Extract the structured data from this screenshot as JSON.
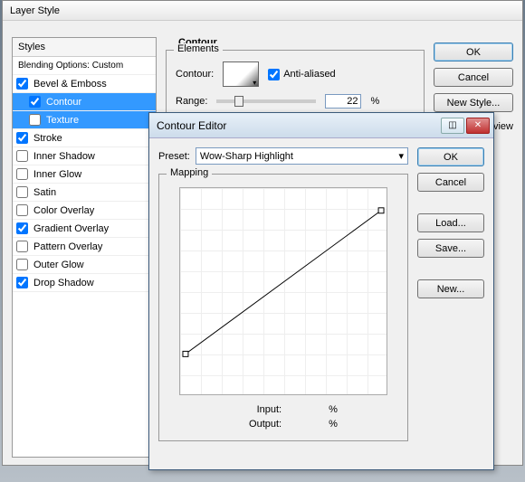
{
  "main": {
    "title": "Layer Style",
    "styles_header": "Styles",
    "blending_label": "Blending Options: Custom",
    "items": [
      {
        "label": "Bevel & Emboss",
        "checked": true,
        "selected": false,
        "sub": false
      },
      {
        "label": "Contour",
        "checked": true,
        "selected": true,
        "sub": true
      },
      {
        "label": "Texture",
        "checked": false,
        "selected": true,
        "sub": true
      },
      {
        "label": "Stroke",
        "checked": true,
        "selected": false,
        "sub": false
      },
      {
        "label": "Inner Shadow",
        "checked": false,
        "selected": false,
        "sub": false
      },
      {
        "label": "Inner Glow",
        "checked": false,
        "selected": false,
        "sub": false
      },
      {
        "label": "Satin",
        "checked": false,
        "selected": false,
        "sub": false
      },
      {
        "label": "Color Overlay",
        "checked": false,
        "selected": false,
        "sub": false
      },
      {
        "label": "Gradient Overlay",
        "checked": true,
        "selected": false,
        "sub": false
      },
      {
        "label": "Pattern Overlay",
        "checked": false,
        "selected": false,
        "sub": false
      },
      {
        "label": "Outer Glow",
        "checked": false,
        "selected": false,
        "sub": false
      },
      {
        "label": "Drop Shadow",
        "checked": true,
        "selected": false,
        "sub": false
      }
    ],
    "section_title": "Contour",
    "elements_legend": "Elements",
    "contour_label": "Contour:",
    "antialias_label": "Anti-aliased",
    "antialias_checked": true,
    "range_label": "Range:",
    "range_value": "22",
    "range_unit": "%",
    "buttons": {
      "ok": "OK",
      "cancel": "Cancel",
      "new_style": "New Style...",
      "preview": "Preview",
      "preview_checked": true
    }
  },
  "dialog": {
    "title": "Contour Editor",
    "preset_label": "Preset:",
    "preset_value": "Wow-Sharp Highlight",
    "mapping_legend": "Mapping",
    "input_label": "Input:",
    "output_label": "Output:",
    "percent": "%",
    "buttons": {
      "ok": "OK",
      "cancel": "Cancel",
      "load": "Load...",
      "save": "Save...",
      "new": "New..."
    }
  }
}
